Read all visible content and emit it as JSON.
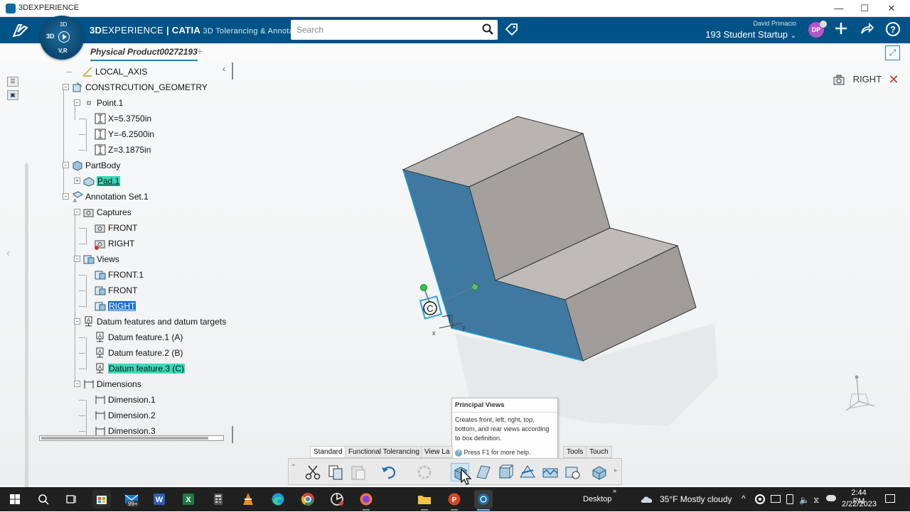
{
  "window": {
    "title": "3DEXPERIENCE",
    "min": "—",
    "max": "☐",
    "close": "✕"
  },
  "appbar": {
    "brand_bold": "3D",
    "brand_mid": "EXPERIENCE",
    "brand_app": "| CATIA",
    "brand_sub": " 3D Tolerancing & Annota...",
    "search_placeholder": "Search",
    "user_name": "David Primacio",
    "space": "193 Student Startup",
    "avatar_initials": "DP",
    "compass_top": "3D",
    "compass_bottom": "V,R",
    "compass_left": "3D"
  },
  "tab": {
    "label": "Physical Product00272193",
    "add": "+"
  },
  "tree": {
    "items": [
      {
        "label": "LOCAL_AXIS"
      },
      {
        "label": "CONSTRCUTION_GEOMETRY"
      },
      {
        "label": "Point.1"
      },
      {
        "label": "X=5.3750in"
      },
      {
        "label": "Y=-6.2500in"
      },
      {
        "label": "Z=3.1875in"
      },
      {
        "label": "PartBody"
      },
      {
        "label": "Pad.1"
      },
      {
        "label": "Annotation Set.1"
      },
      {
        "label": "Captures"
      },
      {
        "label": "FRONT"
      },
      {
        "label": "RIGHT"
      },
      {
        "label": "Views"
      },
      {
        "label": "FRONT.1"
      },
      {
        "label": "FRONT"
      },
      {
        "label": "RIGHT"
      },
      {
        "label": "Datum features and datum targets"
      },
      {
        "label": "Datum feature.1 (A)"
      },
      {
        "label": "Datum feature.2 (B)"
      },
      {
        "label": "Datum feature.3 (C)"
      },
      {
        "label": "Dimensions"
      },
      {
        "label": "Dimension.1"
      },
      {
        "label": "Dimension.2"
      },
      {
        "label": "Dimension.3"
      }
    ]
  },
  "viewport": {
    "capture_label": "RIGHT",
    "datum_letter": "C",
    "axis_x": "x",
    "axis_y": "y"
  },
  "tooltip": {
    "title": "Principal Views",
    "body": "Creates front, left, right, top, bottom, and rear views according to box definition.",
    "help": "Press F1 for more help."
  },
  "action_tabs": [
    "Standard",
    "Functional Tolerancing",
    "View La",
    "Tools",
    "Touch"
  ],
  "taskbar": {
    "mail_badge": "99+",
    "desktop": "Desktop",
    "weather": "35°F  Mostly cloudy",
    "time": "2:44 PM",
    "date": "2/22/2023"
  },
  "colors": {
    "brand_blue": "#005386",
    "face_blue": "#3f78a0",
    "face_gray": "#a9a6a3",
    "highlight": "#3ad9b9",
    "selected": "#1a6fd0",
    "accent_red": "#d0342c"
  }
}
